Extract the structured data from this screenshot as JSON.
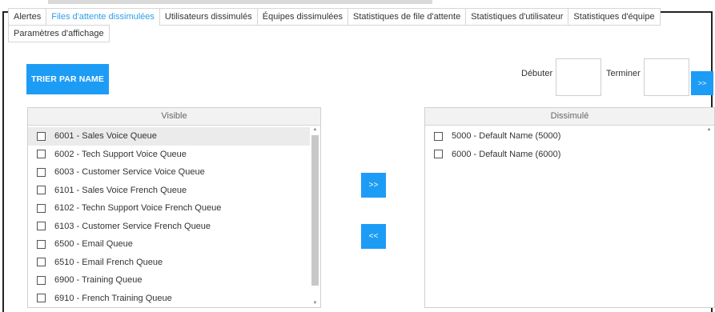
{
  "tabs": [
    {
      "label": "Alertes",
      "active": false
    },
    {
      "label": "Files d'attente dissimulées",
      "active": true
    },
    {
      "label": "Utilisateurs dissimulés",
      "active": false
    },
    {
      "label": "Équipes dissimulées",
      "active": false
    },
    {
      "label": "Statistiques de file d'attente",
      "active": false
    },
    {
      "label": "Statistiques d'utilisateur",
      "active": false
    },
    {
      "label": "Statistiques d'équipe",
      "active": false
    }
  ],
  "tabs_row2": [
    {
      "label": "Paramètres d'affichage",
      "active": false
    }
  ],
  "toolbar": {
    "sort_label": "TRIER PAR NAME",
    "start_label": "Débuter",
    "end_label": "Terminer",
    "start_value": "",
    "end_value": "",
    "go_label": ">>"
  },
  "visible_panel": {
    "title": "Visible",
    "items": [
      "6001 - Sales Voice Queue",
      "6002 - Tech Support Voice Queue",
      "6003 - Customer Service Voice Queue",
      "6101 - Sales Voice French Queue",
      "6102 - Techn Support Voice French Queue",
      "6103 - Customer Service French Queue",
      "6500 - Email Queue",
      "6510 - Email French Queue",
      "6900 - Training Queue",
      "6910 - French Training Queue"
    ]
  },
  "hidden_panel": {
    "title": "Dissimulé",
    "items": [
      "5000 - Default Name (5000)",
      "6000 - Default Name (6000)"
    ]
  },
  "move_buttons": {
    "to_hidden": ">>",
    "to_visible": "<<"
  },
  "colors": {
    "accent": "#1d9cf5",
    "active_tab": "#2f9ee6"
  }
}
